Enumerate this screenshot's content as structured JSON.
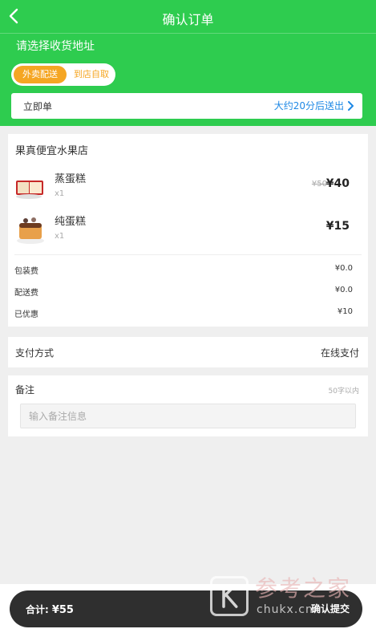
{
  "header": {
    "title": "确认订单",
    "address_prompt": "请选择收货地址",
    "delivery_options": {
      "selected": "外卖配送",
      "other": "到店自取"
    },
    "time_left": "立即单",
    "time_right": "大约20分后送出"
  },
  "shop": {
    "name": "果真便宜水果店",
    "items": [
      {
        "name": "蒸蛋糕",
        "qty": "x1",
        "original_price": "¥50",
        "price": "¥40"
      },
      {
        "name": "纯蛋糕",
        "qty": "x1",
        "price": "¥15"
      }
    ],
    "fees": [
      {
        "label": "包装费",
        "value": "¥0.0"
      },
      {
        "label": "配送费",
        "value": "¥0.0"
      },
      {
        "label": "已优惠",
        "value": "¥10"
      }
    ]
  },
  "payment": {
    "label": "支付方式",
    "value": "在线支付"
  },
  "note": {
    "label": "备注",
    "limit": "50字以内",
    "placeholder": "输入备注信息"
  },
  "footer": {
    "total_label": "合计:",
    "total": "¥55",
    "submit": "确认提交"
  },
  "watermark": {
    "text": "参考之家",
    "url": "chukx.cn"
  },
  "colors": {
    "brand_green": "#2ecc4f",
    "accent_orange": "#f5a623",
    "link_blue": "#1e88e5",
    "bar_dark": "#2f2f2f"
  }
}
